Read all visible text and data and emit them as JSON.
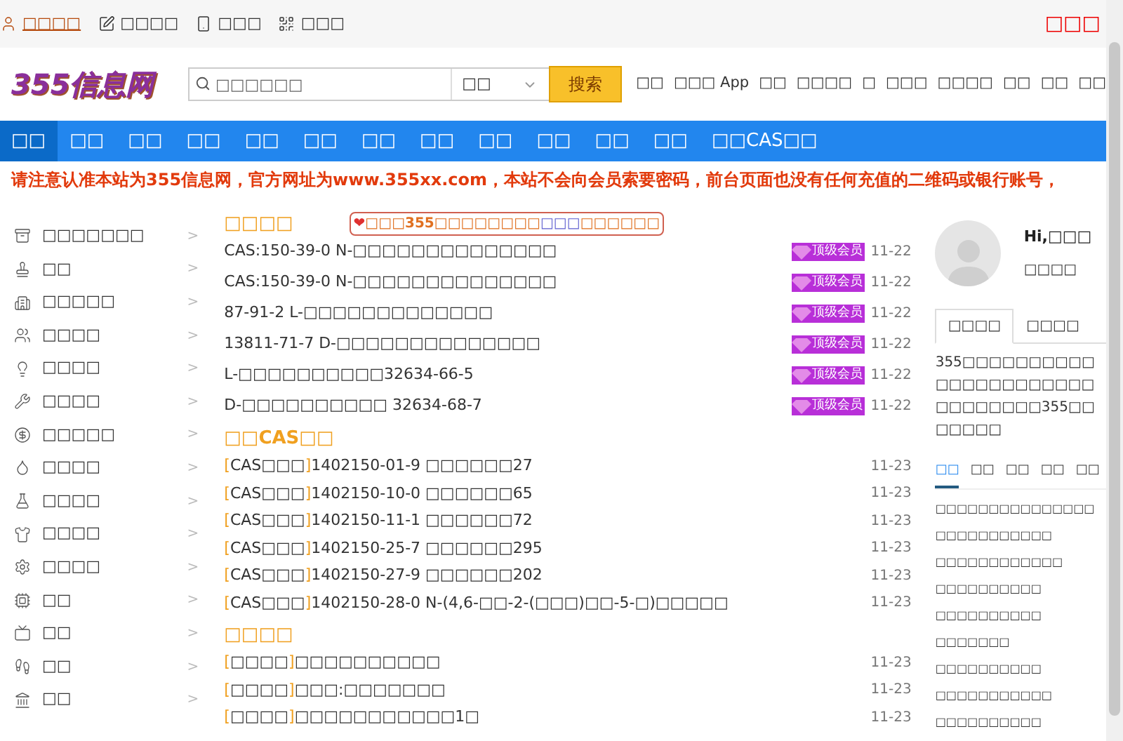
{
  "top_bar": {
    "links": [
      {
        "label": "□□□□",
        "kind": "user",
        "selected": true
      },
      {
        "label": "□□□□",
        "kind": "post",
        "selected": false
      },
      {
        "label": "□□□",
        "kind": "mobile",
        "selected": false
      },
      {
        "label": "□□□",
        "kind": "qr",
        "selected": false
      }
    ],
    "right_link": "□□□"
  },
  "header": {
    "logo": "355信息网",
    "search": {
      "placeholder": "□□□□□□",
      "category": "□□",
      "button": "搜索"
    },
    "links": [
      "□□",
      "□□□ App",
      "□□",
      "□□□□",
      "□",
      "□□□",
      "□□□□",
      "□□",
      "□□",
      "□□"
    ]
  },
  "nav": [
    {
      "label": "□□",
      "selected": true
    },
    {
      "label": "□□",
      "selected": false
    },
    {
      "label": "□□",
      "selected": false
    },
    {
      "label": "□□",
      "selected": false
    },
    {
      "label": "□□",
      "selected": false
    },
    {
      "label": "□□",
      "selected": false
    },
    {
      "label": "□□",
      "selected": false
    },
    {
      "label": "□□",
      "selected": false
    },
    {
      "label": "□□",
      "selected": false
    },
    {
      "label": "□□",
      "selected": false
    },
    {
      "label": "□□",
      "selected": false
    },
    {
      "label": "□□",
      "selected": false
    },
    {
      "label": "□□CAS□□",
      "selected": false
    }
  ],
  "notice": "请注意认准本站为355信息网，官方网址为www.355xx.com，本站不会向会员索要密码，前台页面也没有任何充值的二维码或银行账号，",
  "categories": [
    {
      "label": "□□□□□□□",
      "arrow": ">"
    },
    {
      "label": "□□",
      "arrow": ">"
    },
    {
      "label": "□□□□□",
      "arrow": ">"
    },
    {
      "label": "□□□□",
      "arrow": ">"
    },
    {
      "label": "□□□□",
      "arrow": ">"
    },
    {
      "label": "□□□□",
      "arrow": ">"
    },
    {
      "label": "□□□□□",
      "arrow": ">"
    },
    {
      "label": "□□□□",
      "arrow": ">"
    },
    {
      "label": "□□□□",
      "arrow": ">"
    },
    {
      "label": "□□□□",
      "arrow": ">"
    },
    {
      "label": "□□□□",
      "arrow": ">"
    },
    {
      "label": "□□",
      "arrow": ">"
    },
    {
      "label": "□□",
      "arrow": ">"
    },
    {
      "label": "□□",
      "arrow": ">"
    },
    {
      "label": "□□",
      "arrow": ">"
    }
  ],
  "latest": {
    "title": "□□□□",
    "announcement": [
      {
        "text": "❤",
        "kind": "heart"
      },
      {
        "text": "□□□355□□□□□□□□",
        "kind": "plain"
      },
      {
        "text": "□□□",
        "kind": "link"
      },
      {
        "text": "□□□□□□",
        "kind": "plain"
      }
    ],
    "rows": [
      {
        "text": "CAS:150-39-0 N-□□□□□□□□□□□□□□",
        "badge": "顶级会员",
        "date": "11-22"
      },
      {
        "text": "CAS:150-39-0 N-□□□□□□□□□□□□□□",
        "badge": "顶级会员",
        "date": "11-22"
      },
      {
        "text": "87-91-2 L-□□□□□□□□□□□□□",
        "badge": "顶级会员",
        "date": "11-22"
      },
      {
        "text": "13811-71-7 D-□□□□□□□□□□□□□□",
        "badge": "顶级会员",
        "date": "11-22"
      },
      {
        "text": "L-□□□□□□□□□□32634-66-5",
        "badge": "顶级会员",
        "date": "11-22"
      },
      {
        "text": "D-□□□□□□□□□□ 32634-68-7",
        "badge": "顶级会员",
        "date": "11-22"
      }
    ]
  },
  "cas": {
    "title": "□□CAS□□",
    "brackets": [
      "[",
      "]"
    ],
    "rows": [
      {
        "tag": "CAS□□□",
        "text": "1402150-01-9 □□□□□□27",
        "date": "11-23"
      },
      {
        "tag": "CAS□□□",
        "text": "1402150-10-0 □□□□□□65",
        "date": "11-23"
      },
      {
        "tag": "CAS□□□",
        "text": "1402150-11-1 □□□□□□72",
        "date": "11-23"
      },
      {
        "tag": "CAS□□□",
        "text": "1402150-25-7 □□□□□□295",
        "date": "11-23"
      },
      {
        "tag": "CAS□□□",
        "text": "1402150-27-9 □□□□□□202",
        "date": "11-23"
      },
      {
        "tag": "CAS□□□",
        "text": "1402150-28-0 N-(4,6-□□-2-(□□□)□□-5-□)□□□□□",
        "date": "11-23"
      }
    ]
  },
  "news": {
    "title": "□□□□",
    "brackets": [
      "[",
      "]"
    ],
    "rows": [
      {
        "tag": "□□□□",
        "text": "□□□□□□□□□□",
        "date": "11-23"
      },
      {
        "tag": "□□□□",
        "text": "□□□:□□□□□□□",
        "date": "11-23"
      },
      {
        "tag": "□□□□",
        "text": "□□□□□□□□□□□1□",
        "date": "11-23"
      }
    ]
  },
  "user_panel": {
    "greeting": "Hi,□□□",
    "status": "□□□□",
    "tabs": [
      {
        "label": "□□□□",
        "selected": true
      },
      {
        "label": "□□□□",
        "selected": false
      }
    ],
    "intro": "355□□□□□□□□□□□□□□□□□□□□□□□□□□□□□□355□□□□□□□",
    "sub_tabs": [
      {
        "label": "□□",
        "selected": true
      },
      {
        "label": "□□",
        "selected": false
      },
      {
        "label": "□□",
        "selected": false
      },
      {
        "label": "□□",
        "selected": false
      },
      {
        "label": "□□",
        "selected": false
      }
    ],
    "items": [
      "□□□□□□□□□□□□□□□",
      "□□□□□□□□□□□",
      "□□□□□□□□□□□□",
      "□□□□□□□□□□",
      "□□□□□□□□□□",
      "□□□□□□□",
      "□□□□□□□□□□",
      "□□□□□□□□□□□",
      "□□□□□□□□□□"
    ]
  }
}
